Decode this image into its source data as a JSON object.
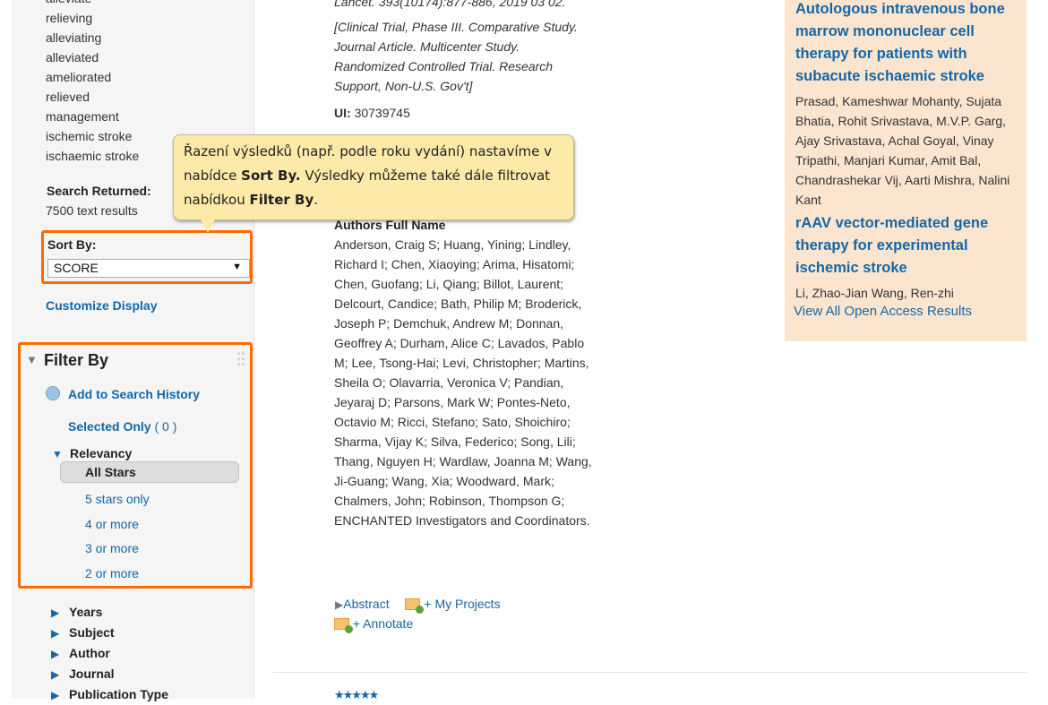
{
  "sidebar": {
    "terms": [
      "alleviate",
      "relieving",
      "alleviating",
      "alleviated",
      "ameliorated",
      "relieved",
      "management",
      "ischemic stroke",
      "ischaemic stroke"
    ],
    "search_returned_label": "Search Returned:",
    "search_returned_value": "7500 text results",
    "sort_by_label": "Sort By:",
    "sort_by_value": "SCORE",
    "customize_display": "Customize Display",
    "filter_by": {
      "title": "Filter By",
      "add_to_history": "Add to Search History",
      "selected_only": "Selected Only",
      "selected_count": "( 0 )",
      "relevancy": "Relevancy",
      "relevancy_options": [
        "All Stars",
        "5 stars only",
        "4 or more",
        "3 or more",
        "2 or more"
      ],
      "collapsed": [
        "Years",
        "Subject",
        "Author",
        "Journal",
        "Publication Type"
      ]
    }
  },
  "tooltip": {
    "part1": "Řazení výsledků (např. podle roku vydání) nastavíme v nabídce ",
    "bold1": "Sort By.",
    "part2": " Výsledky můžeme také dále filtrovat nabídkou ",
    "bold2": "Filter By",
    "part3": "."
  },
  "record": {
    "citation": "Lancet. 393(10174):877-886, 2019 03 02.",
    "pub_types": "[Clinical Trial, Phase III. Comparative Study. Journal Article. Multicenter Study. Randomized Controlled Trial. Research Support, Non-U.S. Gov't]",
    "ui_label": "UI:",
    "ui_value": "30739745",
    "authors_label": "Authors Full Name",
    "authors": "Anderson, Craig S; Huang, Yining; Lindley, Richard I; Chen, Xiaoying; Arima, Hisatomi; Chen, Guofang; Li, Qiang; Billot, Laurent; Delcourt, Candice; Bath, Philip M; Broderick, Joseph P; Demchuk, Andrew M; Donnan, Geoffrey A; Durham, Alice C; Lavados, Pablo M; Lee, Tsong-Hai; Levi, Christopher; Martins, Sheila O; Olavarria, Veronica V; Pandian, Jeyaraj D; Parsons, Mark W; Pontes-Neto, Octavio M; Ricci, Stefano; Sato, Shoichiro; Sharma, Vijay K; Silva, Federico; Song, Lili; Thang, Nguyen H; Wardlaw, Joanna M; Wang, Ji-Guang; Wang, Xia; Woodward, Mark; Chalmers, John; Robinson, Thompson G; ENCHANTED Investigators and Coordinators.",
    "abstract": "Abstract",
    "my_projects": "+ My Projects",
    "annotate": "+ Annotate"
  },
  "open_access": {
    "items": [
      {
        "title": "Autologous intravenous bone marrow mononuclear cell therapy for patients with subacute ischaemic stroke",
        "authors": "Prasad, Kameshwar Mohanty, Sujata Bhatia, Rohit Srivastava, M.V.P. Garg, Ajay Srivastava, Achal Goyal, Vinay Tripathi, Manjari Kumar, Amit Bal, Chandrashekar Vij, Aarti Mishra, Nalini Kant"
      },
      {
        "title": "rAAV vector-mediated gene therapy for experimental ischemic stroke",
        "authors": "Li, Zhao-Jian Wang, Ren-zhi"
      }
    ],
    "view_all": "View All Open Access Results"
  },
  "colors": {
    "highlight": "#ff6a00",
    "link": "#1467a8",
    "open_access_bg": "#fce5cf",
    "tooltip_bg": "#fdeaa8"
  }
}
